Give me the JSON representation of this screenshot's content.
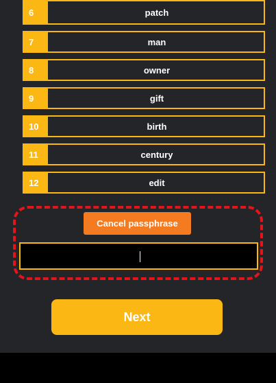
{
  "colors": {
    "accent": "#fbb714",
    "cancel": "#f57b20",
    "highlight": "#e4141b",
    "background": "#232529"
  },
  "words": [
    {
      "index": "6",
      "word": "patch"
    },
    {
      "index": "7",
      "word": "man"
    },
    {
      "index": "8",
      "word": "owner"
    },
    {
      "index": "9",
      "word": "gift"
    },
    {
      "index": "10",
      "word": "birth"
    },
    {
      "index": "11",
      "word": "century"
    },
    {
      "index": "12",
      "word": "edit"
    }
  ],
  "passphrase": {
    "cancel_label": "Cancel passphrase",
    "value": ""
  },
  "next_label": "Next"
}
